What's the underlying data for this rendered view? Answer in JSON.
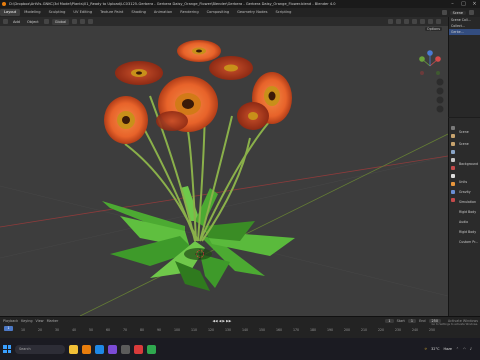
{
  "window": {
    "title": "D:\\Dropbox\\ArtVis-GNKC\\3d Model\\Plants\\01_Ready to Upload\\LC03125-Gerbera - Gerbera Daisy_Orange_Flower\\Blender\\Gerbera - Gerbera Daisy_Orange_Flower.blend - Blender 4.0",
    "controls": [
      "–",
      "□",
      "×"
    ]
  },
  "menubar": {
    "tabs": [
      "Layout",
      "Modeling",
      "Sculpting",
      "UV Editing",
      "Texture Paint",
      "Shading",
      "Animation",
      "Rendering",
      "Compositing",
      "Geometry Nodes",
      "Scripting"
    ],
    "active_tab": "Layout",
    "scene_label": "Scene"
  },
  "viewport_header": {
    "items": [
      "Add",
      "Object"
    ],
    "orientation": "Global",
    "options": "Options"
  },
  "outliner": {
    "rows": [
      "Scene Coll...",
      "Collect...",
      "Gerbe..."
    ]
  },
  "properties": {
    "rows": [
      "Scene",
      "Scene",
      "Background",
      "Units",
      "Gravity",
      "Simulation",
      "Rigid Body",
      "Audio",
      "Rigid Body",
      "Custom Pr..."
    ]
  },
  "timeline": {
    "controls": [
      "Playback",
      "Keying",
      "View",
      "Marker"
    ],
    "current_frame": "1",
    "start_label": "Start",
    "start": "1",
    "end_label": "End",
    "end": "250",
    "ticks": [
      "0",
      "10",
      "20",
      "30",
      "40",
      "50",
      "60",
      "70",
      "80",
      "90",
      "100",
      "110",
      "120",
      "130",
      "140",
      "150",
      "160",
      "170",
      "180",
      "190",
      "200",
      "210",
      "220",
      "230",
      "240",
      "250"
    ],
    "activation_line1": "Activate Windows",
    "activation_line2": "Go to Settings to activate Windows."
  },
  "taskbar": {
    "search_placeholder": "Search",
    "temperature": "32°C",
    "weather": "Haze",
    "time": "",
    "date": ""
  },
  "colors": {
    "petal": "#e8632a",
    "petal_dark": "#a33318",
    "center": "#c8901a",
    "leaf": "#3e9a2a",
    "leaf_light": "#6fc84a",
    "stem": "#8ab04a",
    "grid_red": "#8e3b3b",
    "grid_green": "#647d35",
    "blender_orange": "#e87d0d"
  }
}
